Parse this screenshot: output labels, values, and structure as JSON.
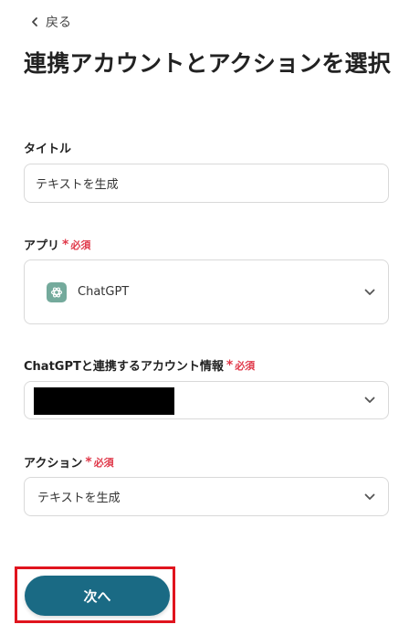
{
  "header": {
    "back_label": "戻る",
    "title": "連携アカウントとアクションを選択"
  },
  "form": {
    "title_field": {
      "label": "タイトル",
      "value": "テキストを生成"
    },
    "app_field": {
      "label": "アプリ",
      "required_label": "必須",
      "value": "ChatGPT",
      "icon": "chatgpt-logo-icon"
    },
    "account_field": {
      "label": "ChatGPTと連携するアカウント情報",
      "required_label": "必須",
      "value": ""
    },
    "action_field": {
      "label": "アクション",
      "required_label": "必須",
      "value": "テキストを生成"
    }
  },
  "footer": {
    "next_label": "次へ"
  },
  "colors": {
    "primary_button": "#1a6a84",
    "required": "#e0394a",
    "highlight": "#e0141e",
    "chatgpt_brand": "#74aa9c"
  }
}
